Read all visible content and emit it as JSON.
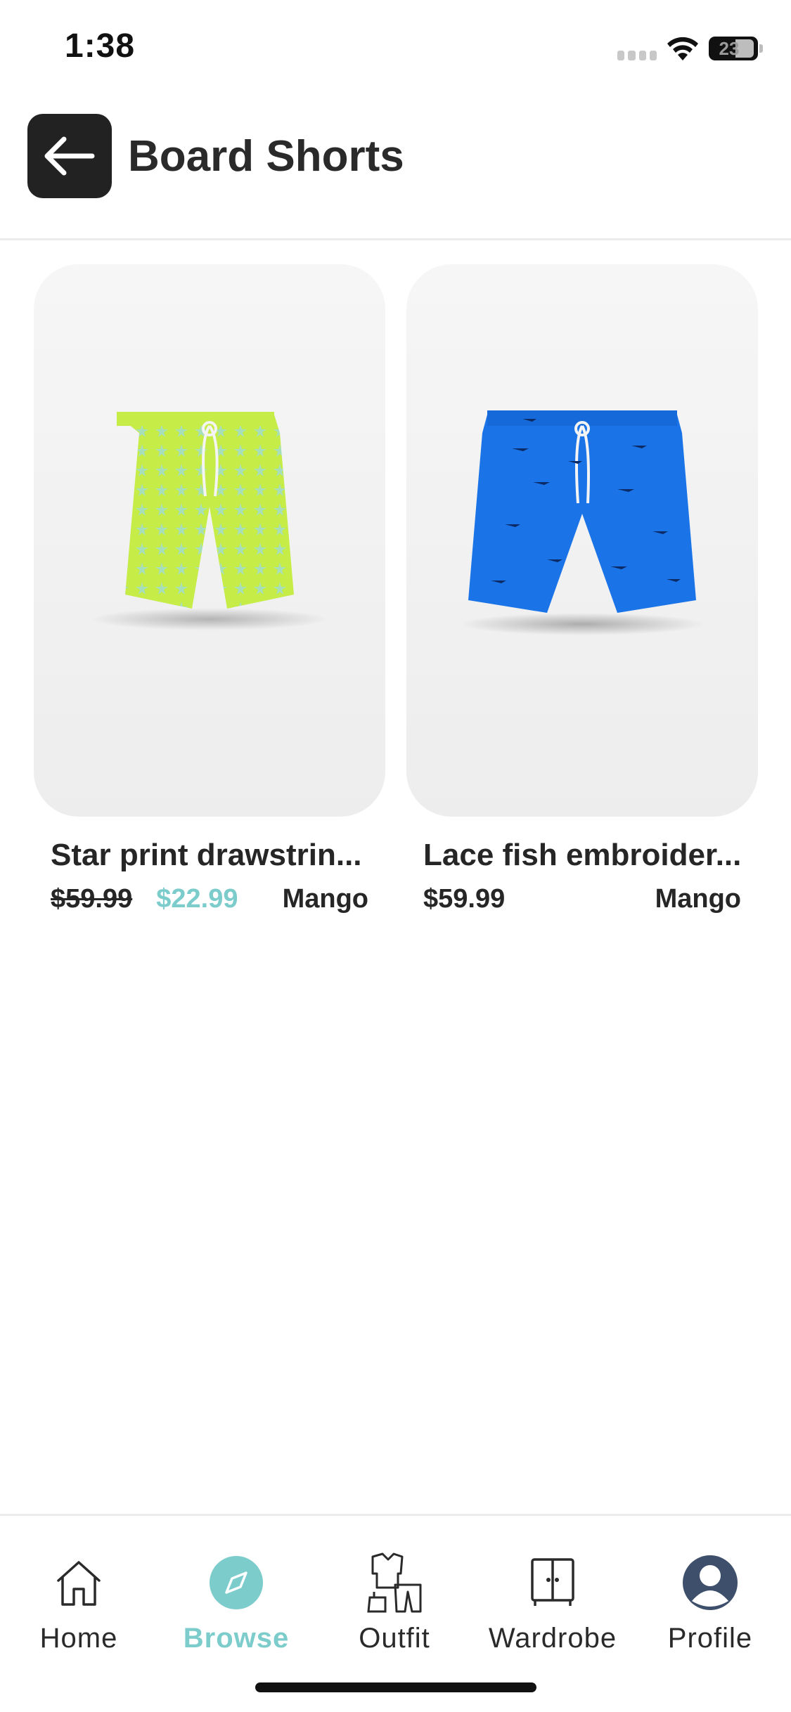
{
  "status_bar": {
    "time": "1:38",
    "battery": "23"
  },
  "header": {
    "title": "Board Shorts",
    "back_icon": "arrow-left-icon"
  },
  "products": [
    {
      "name": "Star print drawstrin...",
      "price_original": "$59.99",
      "price_sale": "$22.99",
      "brand": "Mango",
      "image": "green-board-shorts"
    },
    {
      "name": "Lace fish embroider...",
      "price": "$59.99",
      "brand": "Mango",
      "image": "blue-board-shorts"
    }
  ],
  "nav": {
    "items": [
      {
        "label": "Home",
        "icon": "home-icon"
      },
      {
        "label": "Browse",
        "icon": "compass-icon",
        "active": true
      },
      {
        "label": "Outfit",
        "icon": "outfit-icon"
      },
      {
        "label": "Wardrobe",
        "icon": "wardrobe-icon"
      },
      {
        "label": "Profile",
        "icon": "profile-icon"
      }
    ]
  },
  "colors": {
    "accent": "#7ccccc",
    "dark": "#222222",
    "green_shorts": "#c8ee4c",
    "blue_shorts": "#1a74e8"
  }
}
